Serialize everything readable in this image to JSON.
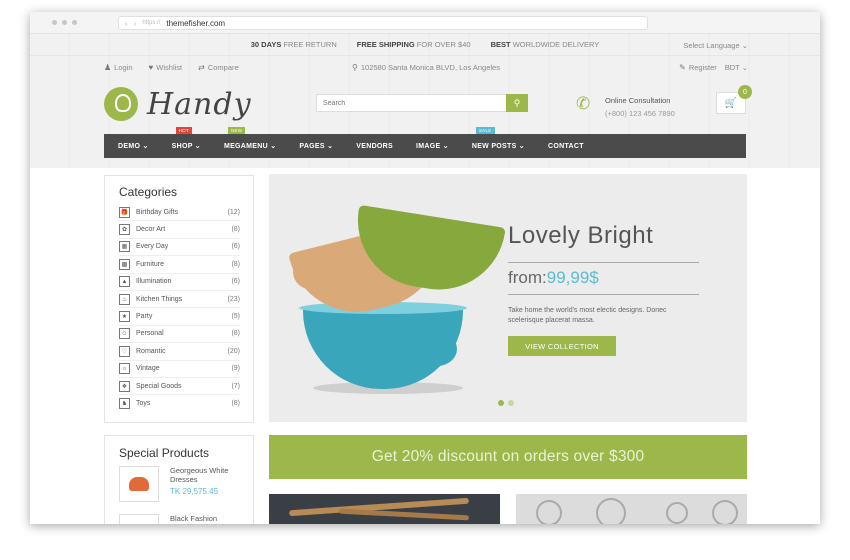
{
  "browser": {
    "url_protocol": "https://",
    "url_host": "themefisher.com"
  },
  "topbar": {
    "promos": [
      {
        "bold": "30 DAYS",
        "rest": "FREE RETURN"
      },
      {
        "bold": "FREE SHIPPING",
        "rest": "FOR OVER $40"
      },
      {
        "bold": "BEST",
        "rest": "WORLDWIDE DELIVERY"
      }
    ],
    "language": "Select Language ⌄"
  },
  "userbar": {
    "login": "Login",
    "wishlist": "Wishlist",
    "compare": "Compare",
    "address": "102580 Santa Monica BLVD, Los Angeles",
    "register": "Register",
    "currency": "BDT ⌄"
  },
  "header": {
    "logo": "Handy",
    "search_placeholder": "Search",
    "consult_title": "Online Consultation",
    "consult_phone": "(+800) 123 456 7890",
    "cart_count": "0"
  },
  "nav": {
    "items": [
      "DEMO ⌄",
      "SHOP ⌄",
      "MEGAMENU ⌄",
      "PAGES ⌄",
      "VENDORS",
      "IMAGE ⌄",
      "NEW POSTS ⌄",
      "CONTACT"
    ],
    "tags": {
      "shop": "HOT",
      "megamenu": "NEW",
      "newposts": "SALE"
    }
  },
  "categories": {
    "title": "Categories",
    "items": [
      {
        "label": "Birthday Gifts",
        "count": "(12)"
      },
      {
        "label": "Decor Art",
        "count": "(8)"
      },
      {
        "label": "Every Day",
        "count": "(6)"
      },
      {
        "label": "Furniture",
        "count": "(8)"
      },
      {
        "label": "Illumination",
        "count": "(6)"
      },
      {
        "label": "Kitchen Things",
        "count": "(23)"
      },
      {
        "label": "Party",
        "count": "(5)"
      },
      {
        "label": "Personal",
        "count": "(8)"
      },
      {
        "label": "Romantic",
        "count": "(20)"
      },
      {
        "label": "Vintage",
        "count": "(9)"
      },
      {
        "label": "Special Goods",
        "count": "(7)"
      },
      {
        "label": "Toys",
        "count": "(8)"
      }
    ]
  },
  "hero": {
    "title": "Lovely Bright",
    "price_prefix": "from:",
    "price": "99,99$",
    "description": "Take home the world's most electic designs. Donec scelerisque placerat massa.",
    "button": "VIEW COLLECTION"
  },
  "special": {
    "title": "Special Products",
    "products": [
      {
        "name": "Georgeous White Dresses",
        "price": "TK 29,575.45"
      },
      {
        "name": "Black Fashion",
        "price": ""
      }
    ]
  },
  "banner": {
    "text": "Get 20% discount on orders over $300"
  },
  "colors": {
    "accent": "#9cb84a",
    "blue": "#5db9d2",
    "nav": "#4b4b4b",
    "hot": "#e0463c"
  }
}
